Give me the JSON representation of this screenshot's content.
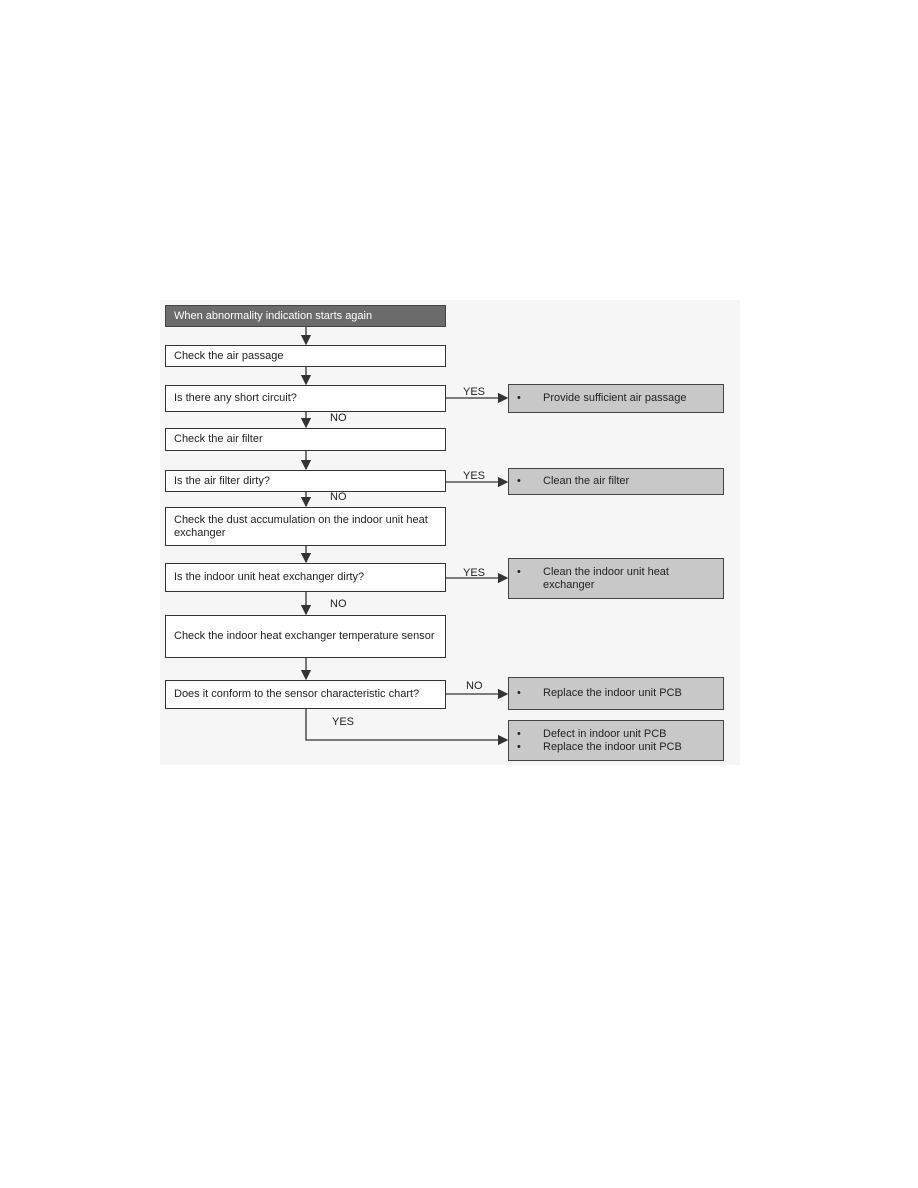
{
  "flowchart": {
    "start": "When abnormality indication starts again",
    "steps": [
      "Check the air passage",
      "Is there any short circuit?",
      "Check the air filter",
      "Is the air filter dirty?",
      "Check the dust accumulation on the indoor unit heat exchanger",
      "Is the indoor unit heat exchanger dirty?",
      "Check the indoor heat exchanger temperature sensor",
      "Does it conform to the sensor characteristic chart?"
    ],
    "actions": [
      [
        "Provide sufficient air passage"
      ],
      [
        "Clean the air filter"
      ],
      [
        "Clean the indoor unit heat exchanger"
      ],
      [
        "Replace the indoor unit PCB"
      ],
      [
        "Defect in indoor unit PCB",
        "Replace the indoor unit PCB"
      ]
    ],
    "labels": {
      "yes": "YES",
      "no": "NO"
    },
    "bullet": "•",
    "colors": {
      "start_box": "#6b6b6b",
      "action_box": "#c8c8c8"
    }
  }
}
